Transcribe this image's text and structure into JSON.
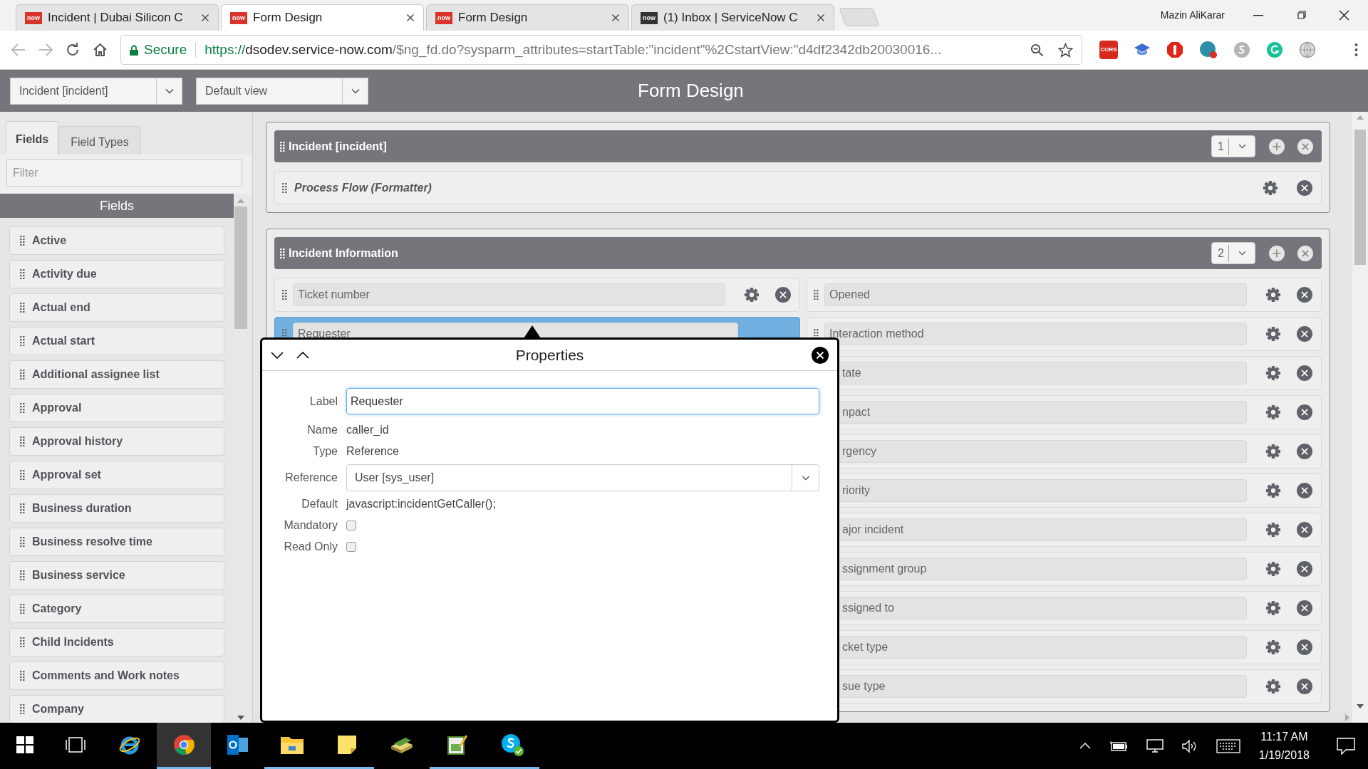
{
  "browser": {
    "tabs": [
      {
        "title": "Incident | Dubai Silicon C",
        "favicon": "now",
        "color": "#d9342b",
        "selected": false
      },
      {
        "title": "Form Design",
        "favicon": "now",
        "color": "#d9342b",
        "selected": true
      },
      {
        "title": "Form Design",
        "favicon": "now",
        "color": "#d9342b",
        "selected": false
      },
      {
        "title": "(1) Inbox | ServiceNow C",
        "favicon": "now",
        "color": "#333333",
        "selected": false
      }
    ],
    "user": "Mazin AliKarar",
    "address": {
      "security": "Secure",
      "scheme": "https://",
      "host": "dsodev.service-now.com",
      "path": "/$ng_fd.do?sysparm_attributes=startTable:\"incident\"%2CstartView:\"d4df2342db20030016..."
    },
    "extensions": [
      {
        "kind": "cors",
        "text": "CORS"
      },
      {
        "kind": "cap"
      },
      {
        "kind": "stop"
      },
      {
        "kind": "badge"
      },
      {
        "kind": "grey"
      },
      {
        "kind": "green"
      },
      {
        "kind": "globe"
      }
    ]
  },
  "header": {
    "table_select": "Incident [incident]",
    "view_select": "Default view",
    "title": "Form Design"
  },
  "sidebar": {
    "tabs": [
      {
        "label": "Fields",
        "selected": true
      },
      {
        "label": "Field Types",
        "selected": false
      }
    ],
    "filter": {
      "placeholder": "Filter"
    },
    "heading": "Fields",
    "items": [
      "Active",
      "Activity due",
      "Actual end",
      "Actual start",
      "Additional assignee list",
      "Approval",
      "Approval history",
      "Approval set",
      "Business duration",
      "Business resolve time",
      "Business service",
      "Category",
      "Child Incidents",
      "Comments and Work notes",
      "Company"
    ]
  },
  "form": {
    "sections": [
      {
        "title": "Incident [incident]",
        "columns": "1",
        "formatters": [
          {
            "label": "Process Flow (Formatter)",
            "selected": false
          }
        ]
      },
      {
        "title": "Incident Information",
        "columns": "2",
        "left_column": [
          {
            "label": "Ticket number",
            "kind": "field",
            "selected": false
          },
          {
            "label": "Requester",
            "kind": "field",
            "selected": true
          }
        ],
        "right_column": [
          {
            "label": "Opened",
            "kind": "field",
            "selected": false
          },
          {
            "label": "Interaction method",
            "kind": "field",
            "selected": false
          },
          {
            "label": "tate",
            "kind": "covered",
            "selected": false
          },
          {
            "label": "npact",
            "kind": "covered",
            "selected": false
          },
          {
            "label": "rgency",
            "kind": "covered",
            "selected": false
          },
          {
            "label": "riority",
            "kind": "covered",
            "selected": false
          },
          {
            "label": "ajor incident",
            "kind": "covered",
            "selected": false
          },
          {
            "label": "ssignment group",
            "kind": "covered",
            "selected": false
          },
          {
            "label": "ssigned to",
            "kind": "covered",
            "selected": false
          },
          {
            "label": "cket type",
            "kind": "covered",
            "selected": false
          },
          {
            "label": "sue type",
            "kind": "covered",
            "selected": false
          }
        ]
      }
    ]
  },
  "properties": {
    "title": "Properties",
    "rows": [
      {
        "kind": "input",
        "label": "Label",
        "value": "Requester"
      },
      {
        "kind": "text",
        "label": "Name",
        "value": "caller_id"
      },
      {
        "kind": "text",
        "label": "Type",
        "value": "Reference"
      },
      {
        "kind": "select",
        "label": "Reference",
        "value": "User [sys_user]"
      },
      {
        "kind": "text",
        "label": "Default",
        "value": "javascript:incidentGetCaller();"
      },
      {
        "kind": "checkbox",
        "label": "Mandatory",
        "checked": false
      },
      {
        "kind": "checkbox",
        "label": "Read Only",
        "checked": false
      }
    ]
  },
  "taskbar": {
    "apps": [
      {
        "kind": "start",
        "selected": false,
        "running": false
      },
      {
        "kind": "taskview",
        "selected": false,
        "running": false
      },
      {
        "kind": "ie",
        "selected": false,
        "running": false
      },
      {
        "kind": "chrome",
        "selected": true,
        "running": true
      },
      {
        "kind": "outlook",
        "selected": false,
        "running": false
      },
      {
        "kind": "explorer",
        "selected": false,
        "running": true
      },
      {
        "kind": "notes",
        "selected": false,
        "running": true
      },
      {
        "kind": "stack",
        "selected": false,
        "running": false
      },
      {
        "kind": "notebook",
        "selected": false,
        "running": true
      },
      {
        "kind": "skype",
        "selected": false,
        "running": true
      }
    ],
    "time": "11:17 AM",
    "date": "1/19/2018"
  }
}
